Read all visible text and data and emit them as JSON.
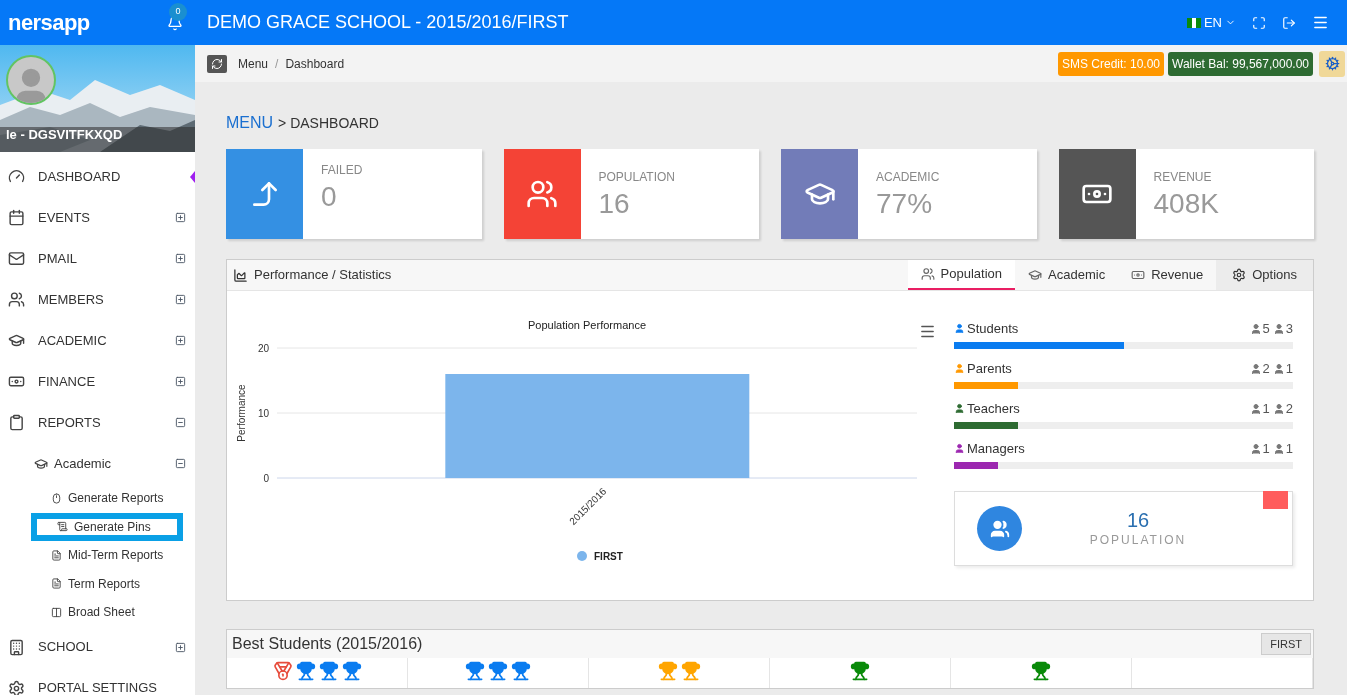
{
  "topbar": {
    "logo": "nersapp",
    "notifications": "0",
    "title": "DEMO GRACE SCHOOL - 2015/2016/FIRST",
    "language": "EN"
  },
  "profile": {
    "name": "le - DGSVITFKXQD"
  },
  "sidebar": {
    "items": [
      {
        "label": "DASHBOARD",
        "selected": true
      },
      {
        "label": "EVENTS",
        "selected": false,
        "expanded": false
      },
      {
        "label": "PMAIL",
        "selected": false,
        "expanded": false
      },
      {
        "label": "MEMBERS",
        "selected": false,
        "expanded": false
      },
      {
        "label": "ACADEMIC",
        "selected": false,
        "expanded": false
      },
      {
        "label": "FINANCE",
        "selected": false,
        "expanded": false
      },
      {
        "label": "REPORTS",
        "selected": false,
        "expanded": true,
        "children": [
          {
            "label": "Academic",
            "expanded": true,
            "children": [
              {
                "label": "Generate Reports",
                "selected": false
              },
              {
                "label": "Generate Pins",
                "selected": true
              },
              {
                "label": "Mid-Term Reports",
                "selected": false
              },
              {
                "label": "Term Reports",
                "selected": false
              },
              {
                "label": "Broad Sheet",
                "selected": false
              }
            ]
          }
        ]
      },
      {
        "label": "SCHOOL",
        "selected": false,
        "expanded": false
      },
      {
        "label": "PORTAL SETTINGS",
        "selected": false
      }
    ]
  },
  "breadcrumb": {
    "items": [
      "Menu",
      "Dashboard"
    ],
    "separator": "/"
  },
  "badges": [
    {
      "label": "SMS Credit: 10.00",
      "color": "#ff9800"
    },
    {
      "label": "Wallet Bal: 99,567,000.00",
      "color": "#2e6b32"
    }
  ],
  "page_title": {
    "link": "MENU",
    "rest": "> DASHBOARD"
  },
  "stat_cards": [
    {
      "label": "FAILED",
      "value": "0",
      "color": "#3490e3"
    },
    {
      "label": "POPULATION",
      "value": "16",
      "color": "#f44336"
    },
    {
      "label": "ACADEMIC",
      "value": "77%",
      "color": "#727cb8"
    },
    {
      "label": "REVENUE",
      "value": "408K",
      "color": "#555555"
    }
  ],
  "panel": {
    "title": "Performance / Statistics",
    "tabs": [
      {
        "label": "Population",
        "selected": true
      },
      {
        "label": "Academic",
        "selected": false
      },
      {
        "label": "Revenue",
        "selected": false
      },
      {
        "label": "Options",
        "selected": false
      }
    ],
    "chart_data": {
      "type": "bar",
      "title": "Population Performance",
      "ylabel": "Performance",
      "categories": [
        "2015/2016"
      ],
      "series": [
        {
          "name": "FIRST",
          "color": "#7cb5ec",
          "values": [
            16
          ]
        }
      ],
      "ylim": [
        0,
        20
      ],
      "yticks": [
        0,
        10,
        20
      ]
    },
    "groups": [
      {
        "label": "Students",
        "male": "5",
        "female": "3",
        "level": 0.5,
        "color": "#0a7cf0"
      },
      {
        "label": "Parents",
        "male": "2",
        "female": "1",
        "level": 0.19,
        "color": "#ff9800"
      },
      {
        "label": "Teachers",
        "male": "1",
        "female": "2",
        "level": 0.19,
        "color": "#2e6b32"
      },
      {
        "label": "Managers",
        "male": "1",
        "female": "1",
        "level": 0.13,
        "color": "#9c27b0"
      }
    ],
    "summary": {
      "value": "16",
      "label": "POPULATION"
    }
  },
  "best_students": {
    "title": "Best Students (2015/2016)",
    "term": "FIRST"
  }
}
